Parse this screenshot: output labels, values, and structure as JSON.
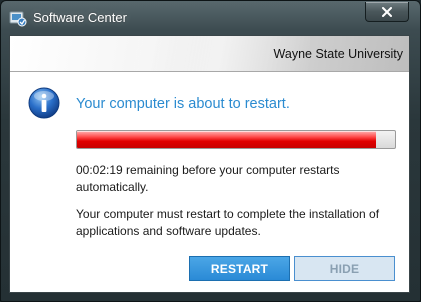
{
  "window": {
    "title": "Software Center",
    "close_glyph": "✕",
    "app_icon": "software-center-icon"
  },
  "banner": {
    "organization": "Wayne State University"
  },
  "message": {
    "icon": "info-icon",
    "headline": "Your computer is about to restart.",
    "countdown": "00:02:19 remaining before your computer restarts automatically.",
    "explanation": "Your computer must restart to complete the installation of applications and software updates."
  },
  "progress": {
    "fraction": 0.94,
    "color": "#e00000"
  },
  "buttons": {
    "restart_label": "RESTART",
    "hide_label": "HIDE"
  }
}
